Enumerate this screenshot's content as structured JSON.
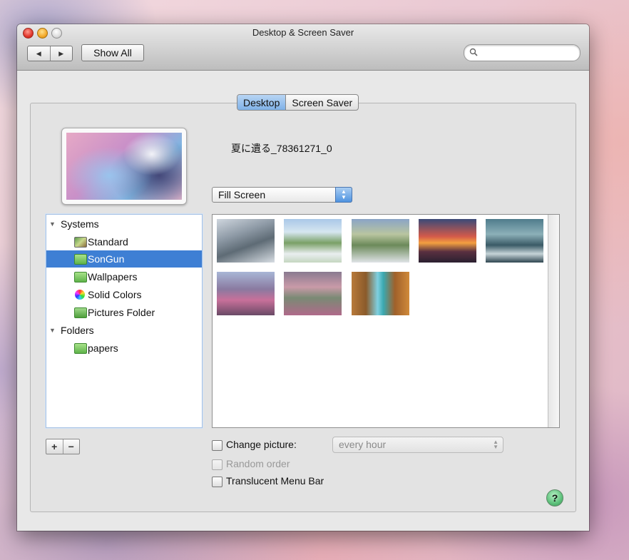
{
  "window": {
    "title": "Desktop & Screen Saver",
    "back_glyph": "◀",
    "forward_glyph": "▶",
    "show_all": "Show All",
    "search_placeholder": ""
  },
  "tabs": [
    {
      "label": "Desktop",
      "active": true
    },
    {
      "label": "Screen Saver",
      "active": false
    }
  ],
  "current_picture": {
    "name": "夏に遺る_78361271_0",
    "fit_mode": "Fill Screen"
  },
  "sidebar": {
    "groups": [
      {
        "label": "Systems",
        "expanded": true,
        "disclosure": "▼",
        "items": [
          {
            "label": "Standard",
            "icon": "photo-frame-icon",
            "selected": false
          },
          {
            "label": "SonGun",
            "icon": "folder-icon",
            "selected": true
          },
          {
            "label": "Wallpapers",
            "icon": "folder-icon",
            "selected": false
          },
          {
            "label": "Solid Colors",
            "icon": "color-wheel-icon",
            "selected": false
          },
          {
            "label": "Pictures Folder",
            "icon": "pictures-folder-icon",
            "selected": false
          }
        ]
      },
      {
        "label": "Folders",
        "expanded": true,
        "disclosure": "▼",
        "items": [
          {
            "label": "papers",
            "icon": "folder-icon",
            "selected": false
          }
        ]
      }
    ]
  },
  "thumbnails": [
    {
      "name": "snowy-battle-thumbnail"
    },
    {
      "name": "valley-plains-thumbnail"
    },
    {
      "name": "mountain-village-thumbnail"
    },
    {
      "name": "sunset-thumbnail"
    },
    {
      "name": "harbor-city-thumbnail"
    },
    {
      "name": "blossom-mountain-thumbnail"
    },
    {
      "name": "blossom-valley-thumbnail"
    },
    {
      "name": "waterfall-thumbnail"
    }
  ],
  "controls": {
    "plus": "+",
    "minus": "−",
    "change_picture": {
      "label": "Change picture:",
      "checked": false
    },
    "interval": {
      "value": "every hour",
      "enabled": false
    },
    "random_order": {
      "label": "Random order",
      "checked": false,
      "enabled": false
    },
    "translucent_menu_bar": {
      "label": "Translucent Menu Bar",
      "checked": false
    },
    "help": "?"
  },
  "colors": {
    "selection": "#3e7fd4",
    "tab_active": "#7fb1e7",
    "close": "#e0352a",
    "minimize": "#f3a92a",
    "help": "#5cc07a"
  }
}
